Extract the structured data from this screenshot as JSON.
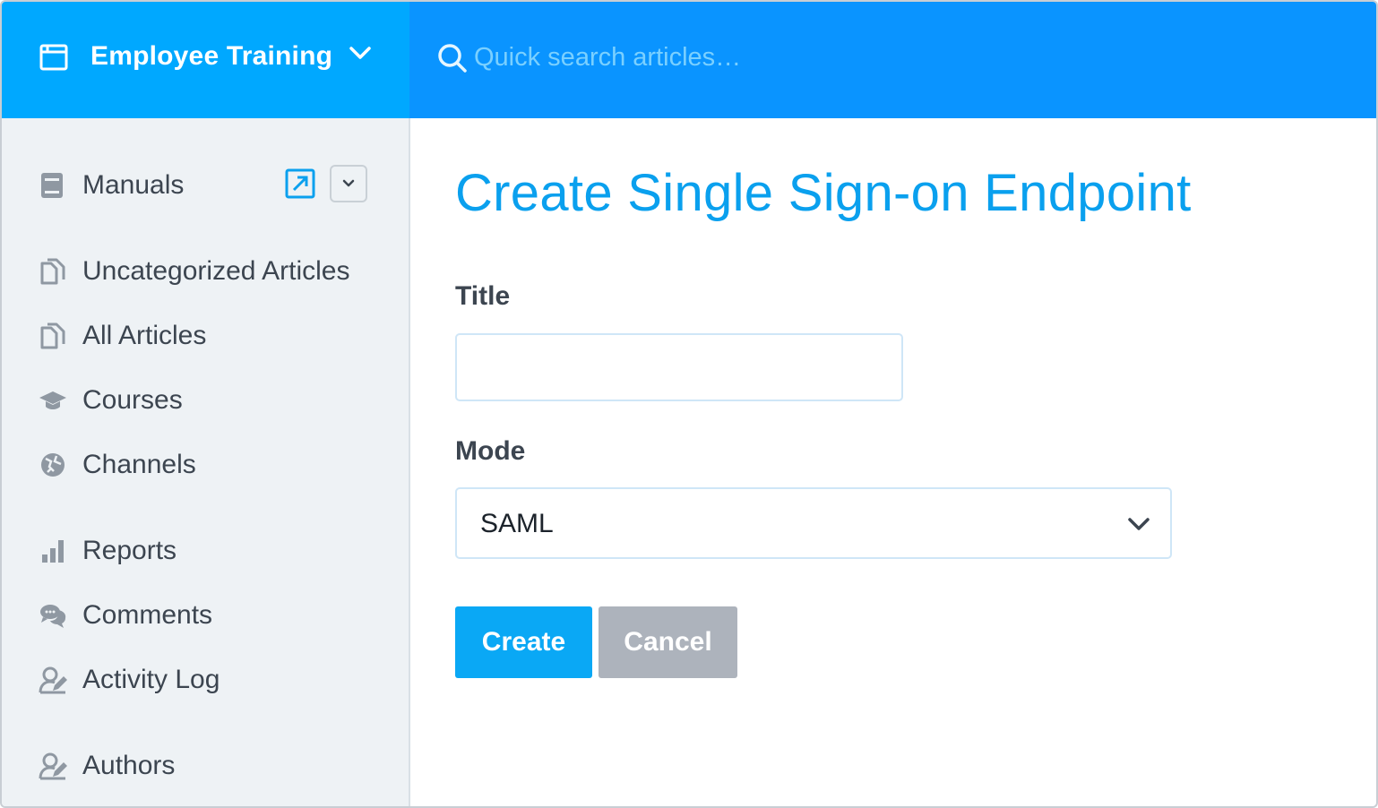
{
  "header": {
    "app_title": "Employee Training",
    "app_icon": "browser-window-icon",
    "search_placeholder": "Quick search articles…",
    "colors": {
      "brand": "#00a8ff",
      "topbar": "#0a94ff"
    }
  },
  "sidebar": {
    "manuals": {
      "label": "Manuals",
      "icon": "book-icon"
    },
    "items": [
      {
        "label": "Uncategorized Articles",
        "icon": "documents-icon"
      },
      {
        "label": "All Articles",
        "icon": "documents-icon"
      },
      {
        "label": "Courses",
        "icon": "graduation-cap-icon"
      },
      {
        "label": "Channels",
        "icon": "globe-icon"
      },
      {
        "label": "Reports",
        "icon": "bar-chart-icon"
      },
      {
        "label": "Comments",
        "icon": "comments-icon"
      },
      {
        "label": "Activity Log",
        "icon": "user-edit-icon"
      },
      {
        "label": "Authors",
        "icon": "user-edit-icon"
      }
    ]
  },
  "main": {
    "page_title": "Create Single Sign-on Endpoint",
    "form": {
      "title_label": "Title",
      "title_value": "",
      "mode_label": "Mode",
      "mode_value": "SAML"
    },
    "buttons": {
      "create": "Create",
      "cancel": "Cancel"
    },
    "colors": {
      "accent": "#0aa8f5",
      "cancel": "#adb3bc"
    }
  }
}
